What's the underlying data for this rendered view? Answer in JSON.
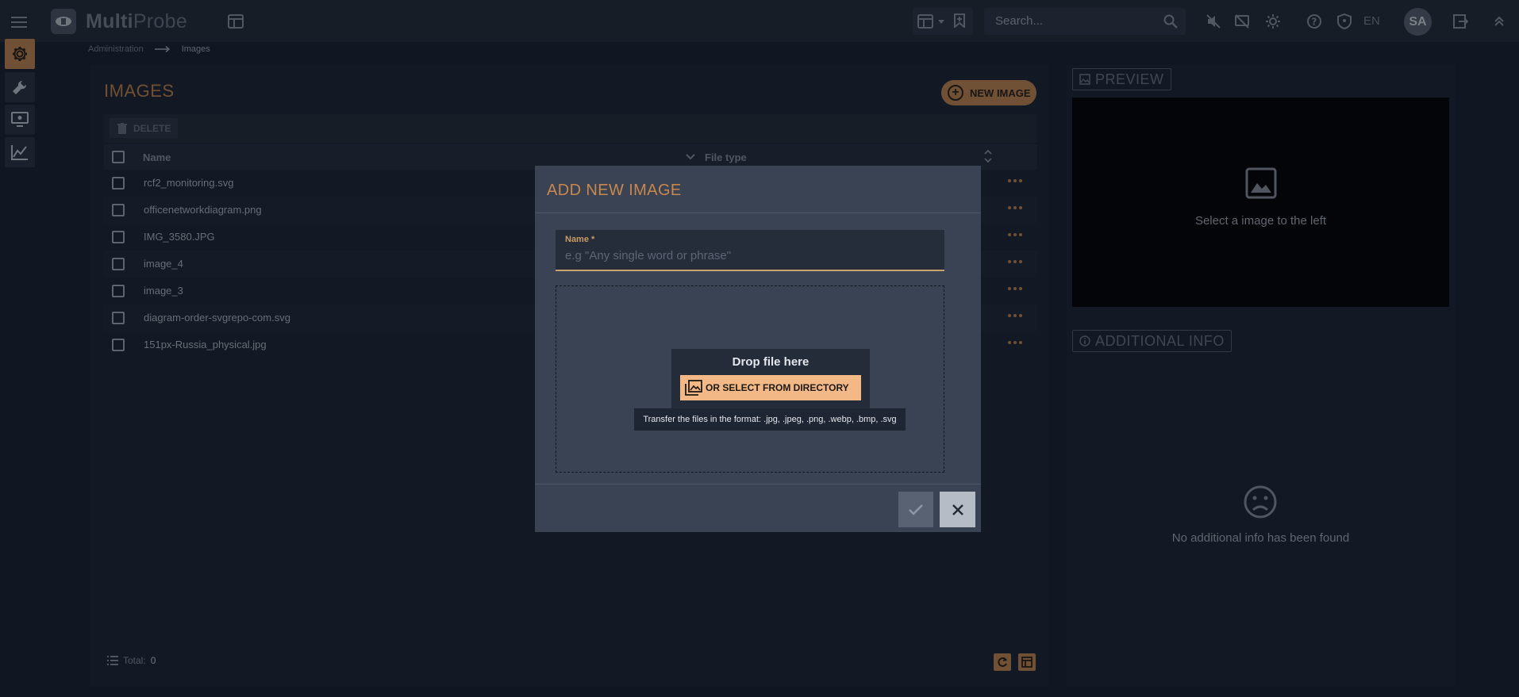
{
  "app": {
    "title_part1": "Multi",
    "title_part2": "Probe",
    "colors": {
      "accent": "#c88a52",
      "background": "#1a2130",
      "panel": "#242c3a"
    }
  },
  "topbar": {
    "search_placeholder": "Search...",
    "language": "EN",
    "user_initials": "SA",
    "icons": [
      "menu-icon",
      "dashboard-icon",
      "layout-icon",
      "bookmark-icon",
      "search-icon",
      "sound-off-icon",
      "message-off-icon",
      "brightness-icon",
      "help-icon",
      "shield-icon",
      "logout-icon",
      "collapse-icon"
    ]
  },
  "rail": {
    "items": [
      {
        "icon": "gear-icon",
        "active": true
      },
      {
        "icon": "wrench-icon",
        "active": false
      },
      {
        "icon": "monitor-icon",
        "active": false
      },
      {
        "icon": "chart-icon",
        "active": false
      }
    ]
  },
  "breadcrumb": {
    "parent": "Administration",
    "current": "Images"
  },
  "images": {
    "title": "IMAGES",
    "new_button": "NEW IMAGE",
    "delete_button": "DELETE",
    "columns": {
      "name": "Name",
      "file_type": "File type"
    },
    "rows": [
      {
        "name": "rcf2_monitoring.svg"
      },
      {
        "name": "officenetworkdiagram.png"
      },
      {
        "name": "IMG_3580.JPG"
      },
      {
        "name": "image_4"
      },
      {
        "name": "image_3"
      },
      {
        "name": "diagram-order-svgrepo-com.svg"
      },
      {
        "name": "151px-Russia_physical.jpg"
      }
    ],
    "footer": {
      "total_label": "Total:",
      "total_value": "0"
    }
  },
  "preview": {
    "label": "PREVIEW",
    "empty_text": "Select a image to the left"
  },
  "info": {
    "label": "ADDITIONAL INFO",
    "empty_text": "No additional info has been found"
  },
  "dialog": {
    "title": "ADD NEW IMAGE",
    "name_label": "Name",
    "required_mark": "*",
    "name_placeholder": "e.g \"Any single word or phrase\"",
    "name_value": "",
    "drop_text": "Drop file here",
    "select_button": "OR SELECT FROM DIRECTORY",
    "formats_hint": "Transfer the files in the format: .jpg, .jpeg, .png, .webp, .bmp, .svg"
  }
}
